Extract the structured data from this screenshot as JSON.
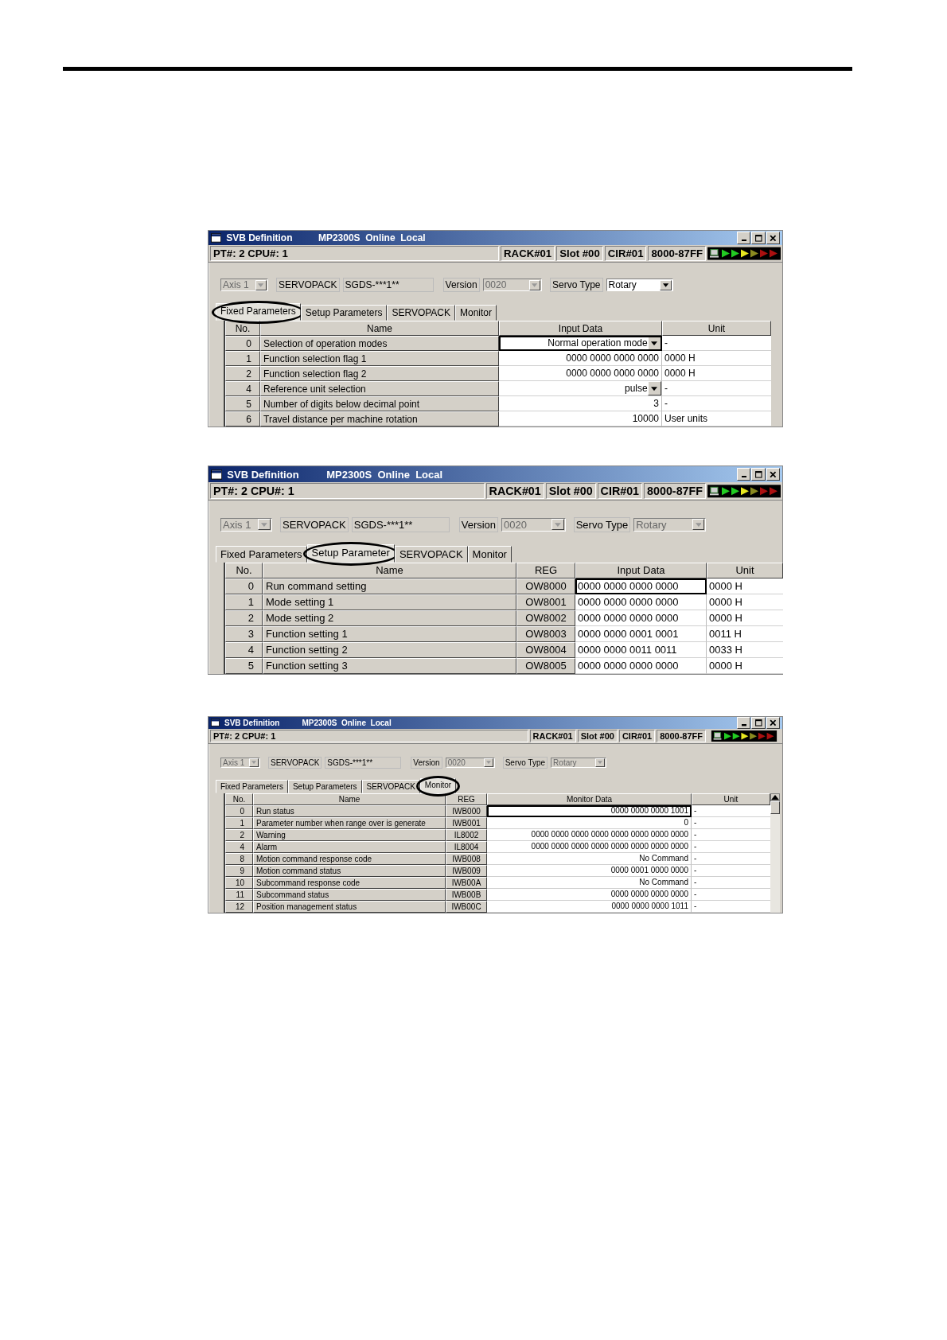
{
  "windows": [
    {
      "title": "SVB Definition",
      "info": "MP2300S  Online  Local",
      "cpu": "PT#: 2 CPU#: 1",
      "status_fields": [
        "RACK#01",
        "Slot #00",
        "CIR#01",
        "8000-87FF"
      ],
      "axis": {
        "value": "Axis 1",
        "disabled": true
      },
      "servopack": {
        "label": "SERVOPACK",
        "value": "SGDS-***1**"
      },
      "version": {
        "label": "Version",
        "value": "0020",
        "disabled": true
      },
      "servo_type": {
        "label": "Servo Type",
        "value": "Rotary",
        "disabled": false
      },
      "tabs": [
        {
          "label": "Fixed Parameters",
          "selected": true
        },
        {
          "label": "Setup Parameters",
          "selected": false
        },
        {
          "label": "SERVOPACK",
          "selected": false
        },
        {
          "label": "Monitor",
          "selected": false
        }
      ],
      "table": {
        "columns": [
          {
            "label": "No.",
            "kind": "number"
          },
          {
            "label": "Name",
            "kind": "name"
          },
          {
            "label": "Input Data",
            "kind": "value"
          },
          {
            "label": "Unit",
            "kind": "unit"
          }
        ],
        "rows": [
          {
            "cells": [
              "0",
              "Selection of operation modes",
              "Normal operation mode",
              "-"
            ],
            "focused": true,
            "dropdown": true
          },
          {
            "cells": [
              "1",
              "Function selection flag 1",
              "0000 0000 0000 0000",
              "0000 H"
            ],
            "focused": false,
            "dropdown": false
          },
          {
            "cells": [
              "2",
              "Function selection flag 2",
              "0000 0000 0000 0000",
              "0000 H"
            ],
            "focused": false,
            "dropdown": false
          },
          {
            "cells": [
              "4",
              "Reference unit selection",
              "pulse",
              "-"
            ],
            "focused": false,
            "dropdown": true
          },
          {
            "cells": [
              "5",
              "Number of digits below decimal point",
              "3",
              "-"
            ],
            "focused": false,
            "dropdown": false
          },
          {
            "cells": [
              "6",
              "Travel distance per machine rotation",
              "10000",
              "User units"
            ],
            "focused": false,
            "dropdown": false
          }
        ]
      }
    },
    {
      "title": "SVB Definition",
      "info": "MP2300S  Online  Local",
      "cpu": "PT#: 2 CPU#: 1",
      "status_fields": [
        "RACK#01",
        "Slot #00",
        "CIR#01",
        "8000-87FF"
      ],
      "axis": {
        "value": "Axis 1",
        "disabled": true
      },
      "servopack": {
        "label": "SERVOPACK",
        "value": "SGDS-***1**"
      },
      "version": {
        "label": "Version",
        "value": "0020",
        "disabled": true
      },
      "servo_type": {
        "label": "Servo Type",
        "value": "Rotary",
        "disabled": true
      },
      "tabs": [
        {
          "label": "Fixed Parameters",
          "selected": false
        },
        {
          "label": "Setup Parameter",
          "selected": true
        },
        {
          "label": "SERVOPACK",
          "selected": false
        },
        {
          "label": "Monitor",
          "selected": false
        }
      ],
      "table": {
        "columns": [
          {
            "label": "No.",
            "kind": "number"
          },
          {
            "label": "Name",
            "kind": "name"
          },
          {
            "label": "REG",
            "kind": "reg"
          },
          {
            "label": "Input Data",
            "kind": "text"
          },
          {
            "label": "Unit",
            "kind": "unit"
          }
        ],
        "rows": [
          {
            "cells": [
              "0",
              "Run command setting",
              "OW8000",
              "0000 0000 0000 0000",
              "0000 H"
            ],
            "focused": true
          },
          {
            "cells": [
              "1",
              "Mode setting 1",
              "OW8001",
              "0000 0000 0000 0000",
              "0000 H"
            ],
            "focused": false
          },
          {
            "cells": [
              "2",
              "Mode setting 2",
              "OW8002",
              "0000 0000 0000 0000",
              "0000 H"
            ],
            "focused": false
          },
          {
            "cells": [
              "3",
              "Function setting 1",
              "OW8003",
              "0000 0000 0001 0001",
              "0011 H"
            ],
            "focused": false
          },
          {
            "cells": [
              "4",
              "Function setting 2",
              "OW8004",
              "0000 0000 0011 0011",
              "0033 H"
            ],
            "focused": false
          },
          {
            "cells": [
              "5",
              "Function setting 3",
              "OW8005",
              "0000 0000 0000 0000",
              "0000 H"
            ],
            "focused": false
          }
        ]
      }
    },
    {
      "title": "SVB Definition",
      "info": "MP2300S  Online  Local",
      "cpu": "PT#: 2 CPU#: 1",
      "status_fields": [
        "RACK#01",
        "Slot #00",
        "CIR#01",
        "8000-87FF"
      ],
      "axis": {
        "value": "Axis 1",
        "disabled": true
      },
      "servopack": {
        "label": "SERVOPACK",
        "value": "SGDS-***1**"
      },
      "version": {
        "label": "Version",
        "value": "0020",
        "disabled": true
      },
      "servo_type": {
        "label": "Servo Type",
        "value": "Rotary",
        "disabled": true
      },
      "tabs": [
        {
          "label": "Fixed Parameters",
          "selected": false
        },
        {
          "label": "Setup Parameters",
          "selected": false
        },
        {
          "label": "SERVOPACK",
          "selected": false
        },
        {
          "label": "Monitor",
          "selected": true
        }
      ],
      "table": {
        "columns": [
          {
            "label": "No.",
            "kind": "number"
          },
          {
            "label": "Name",
            "kind": "name"
          },
          {
            "label": "REG",
            "kind": "reg"
          },
          {
            "label": "Monitor Data",
            "kind": "value"
          },
          {
            "label": "Unit",
            "kind": "unit"
          }
        ],
        "scroll_bar": true,
        "rows": [
          {
            "cells": [
              "0",
              "Run status",
              "IWB000",
              "0000 0000 0000 1001",
              "-"
            ],
            "focused": true
          },
          {
            "cells": [
              "1",
              "Parameter number when range over is generate",
              "IWB001",
              "0",
              "-"
            ],
            "focused": false
          },
          {
            "cells": [
              "2",
              "Warning",
              "IL8002",
              "0000 0000 0000 0000 0000 0000 0000 0000",
              "-"
            ],
            "focused": false
          },
          {
            "cells": [
              "4",
              "Alarm",
              "IL8004",
              "0000 0000 0000 0000 0000 0000 0000 0000",
              "-"
            ],
            "focused": false
          },
          {
            "cells": [
              "8",
              "Motion command response code",
              "IWB008",
              "No Command",
              "-"
            ],
            "focused": false
          },
          {
            "cells": [
              "9",
              "Motion command status",
              "IWB009",
              "0000 0001 0000 0000",
              "-"
            ],
            "focused": false
          },
          {
            "cells": [
              "10",
              "Subcommand response code",
              "IWB00A",
              "No Command",
              "-"
            ],
            "focused": false
          },
          {
            "cells": [
              "11",
              "Subcommand status",
              "IWB00B",
              "0000 0000 0000 0000",
              "-"
            ],
            "focused": false
          },
          {
            "cells": [
              "12",
              "Position management status",
              "IWB00C",
              "0000 0000 0000 1011",
              "-"
            ],
            "focused": false
          }
        ]
      }
    }
  ]
}
